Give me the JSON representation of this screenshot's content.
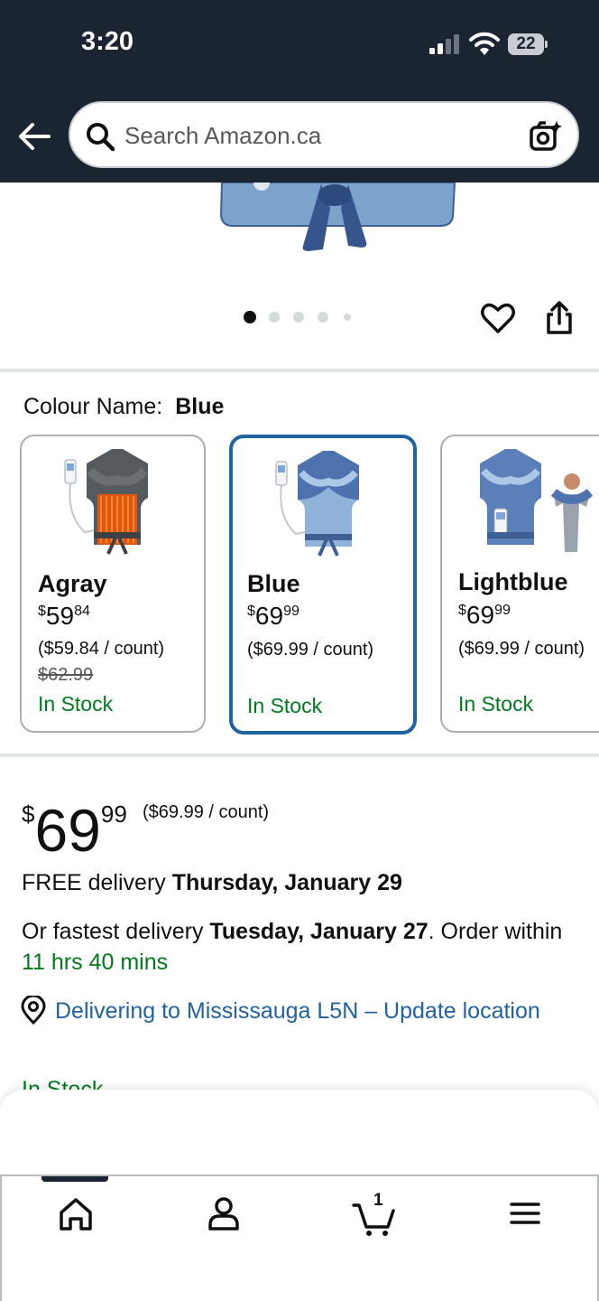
{
  "status_bar": {
    "time": "3:20",
    "battery": "22"
  },
  "header": {
    "search_placeholder": "Search Amazon.ca"
  },
  "gallery": {
    "dot_count": 5,
    "active_dot": 0
  },
  "colour": {
    "label": "Colour Name:",
    "selected": "Blue",
    "options": [
      {
        "name": "Agray",
        "price_whole": "59",
        "price_frac": "84",
        "currency": "$",
        "unit_price": "($59.84 / count)",
        "list_price": "$62.99",
        "stock": "In Stock"
      },
      {
        "name": "Blue",
        "price_whole": "69",
        "price_frac": "99",
        "currency": "$",
        "unit_price": "($69.99 / count)",
        "stock": "In Stock"
      },
      {
        "name": "Lightblue",
        "price_whole": "69",
        "price_frac": "99",
        "currency": "$",
        "unit_price": "($69.99 / count)",
        "stock": "In Stock"
      }
    ]
  },
  "buybox": {
    "currency": "$",
    "price_whole": "69",
    "price_frac": "99",
    "unit_price": "($69.99 / count)",
    "delivery_prefix": "FREE delivery ",
    "delivery_date": "Thursday, January 29",
    "fastest_prefix": "Or fastest delivery ",
    "fastest_date": "Tuesday, January 27",
    "fastest_mid": ". Order within ",
    "countdown": "11 hrs 40 mins",
    "location": "Delivering to Mississauga L5N – Update location",
    "stock_partial": "In Stock"
  },
  "tabbar": {
    "cart_count": "1",
    "active": "home"
  },
  "colors": {
    "header_bg": "#1b2431",
    "link": "#2162a1",
    "in_stock": "#007a1c",
    "selected_border": "#2162a1"
  }
}
